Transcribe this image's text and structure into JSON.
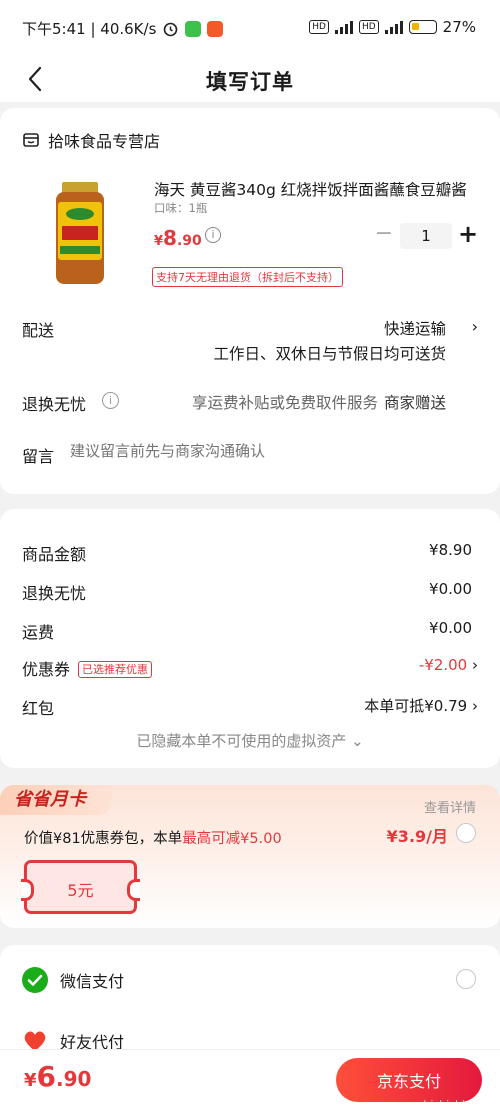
{
  "status": {
    "time_speed": "下午5:41 | 40.6K/s",
    "battery": "27%"
  },
  "header": {
    "title": "填写订单"
  },
  "store": {
    "name": "拾味食品专营店"
  },
  "product": {
    "title": "海天 黄豆酱340g 红烧拌饭拌面酱蘸食豆瓣酱",
    "spec": "口味：1瓶",
    "price_symbol": "¥",
    "price_int": "8",
    "price_dec": ".90",
    "quantity": "1",
    "return_policy": "支持7天无理由退货（拆封后不支持）",
    "image": "jar-of-soybean-sauce"
  },
  "delivery": {
    "label": "配送",
    "method": "快递运输",
    "note": "工作日、双休日与节假日均可送货"
  },
  "worry_free": {
    "label": "退换无忧",
    "desc": "享运费补贴或免费取件服务",
    "gift": "商家赠送"
  },
  "message": {
    "label": "留言",
    "placeholder": "建议留言前先与商家沟通确认"
  },
  "summary": {
    "goods_label": "商品金额",
    "goods_value": "¥8.90",
    "worry_label": "退换无忧",
    "worry_value": "¥0.00",
    "shipping_label": "运费",
    "shipping_value": "¥0.00",
    "coupon_label": "优惠券",
    "coupon_tag": "已选推荐优惠",
    "coupon_value": "-¥2.00",
    "redpacket_label": "红包",
    "redpacket_value": "本单可抵¥0.79",
    "hidden_assets": "已隐藏本单不可使用的虚拟资产"
  },
  "monthly_card": {
    "badge": "省省月卡",
    "view_detail": "查看详情",
    "desc_prefix": "价值¥81优惠券包，本单",
    "desc_highlight": "最高可减¥5.00",
    "price": "¥3.9/月",
    "voucher": "5元"
  },
  "payment": {
    "wechat": "微信支付",
    "friend": "好友代付"
  },
  "footer": {
    "total_symbol": "¥",
    "total_int": "6",
    "total_dec": ".90",
    "pay_button": "京东支付",
    "watermark": "zhizhizhi.com"
  },
  "colors": {
    "accent": "#e4393c",
    "wechat": "#1aad19"
  }
}
